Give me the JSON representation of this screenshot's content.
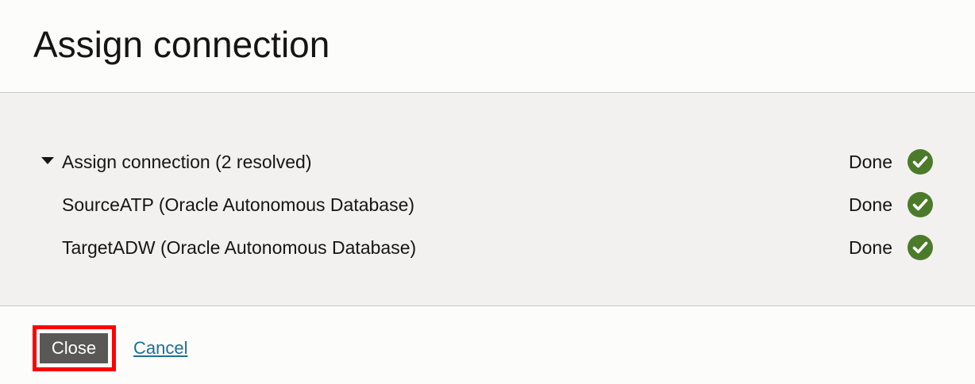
{
  "dialog": {
    "title": "Assign connection"
  },
  "group": {
    "label": "Assign connection (2 resolved)",
    "status": "Done",
    "expanded": true,
    "items": [
      {
        "label": "SourceATP (Oracle Autonomous Database)",
        "status": "Done"
      },
      {
        "label": "TargetADW (Oracle Autonomous Database)",
        "status": "Done"
      }
    ]
  },
  "icons": {
    "expand": "caret-down-icon",
    "status": "check-circle-icon"
  },
  "colors": {
    "success": "#4b7b2a",
    "button_bg": "#5a5856",
    "link": "#1d6f95",
    "highlight": "#ff0000"
  },
  "footer": {
    "close_label": "Close",
    "cancel_label": "Cancel"
  }
}
